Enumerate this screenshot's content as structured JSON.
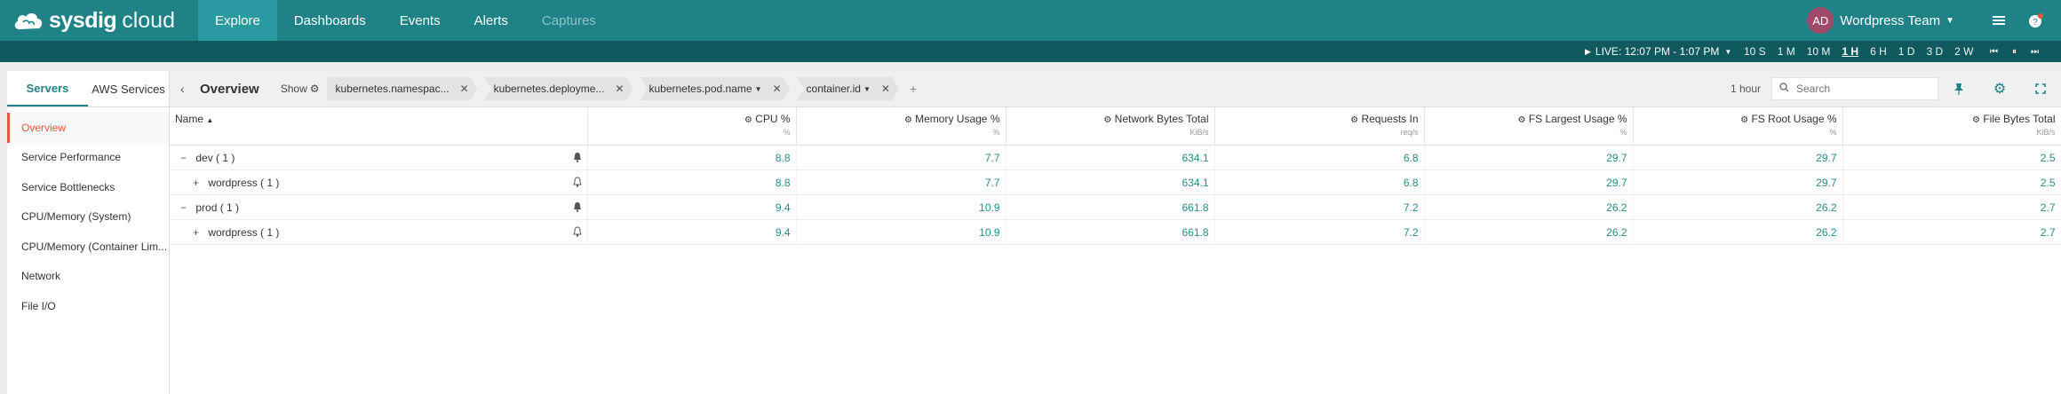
{
  "app": {
    "brand_bold": "sysdig",
    "brand_light": "cloud"
  },
  "nav": {
    "items": [
      {
        "label": "Explore"
      },
      {
        "label": "Dashboards"
      },
      {
        "label": "Events"
      },
      {
        "label": "Alerts"
      },
      {
        "label": "Captures"
      }
    ]
  },
  "user": {
    "initials": "AD",
    "team": "Wordpress Team"
  },
  "timebar": {
    "live": "LIVE: 12:07 PM - 1:07 PM",
    "ranges": [
      "10 S",
      "1 M",
      "10 M",
      "1 H",
      "6 H",
      "1 D",
      "3 D",
      "2 W"
    ],
    "active_range": "1 H"
  },
  "left": {
    "tabs": [
      {
        "label": "Servers"
      },
      {
        "label": "AWS Services"
      }
    ],
    "items": [
      {
        "label": "Overview"
      },
      {
        "label": "Service Performance"
      },
      {
        "label": "Service Bottlenecks"
      },
      {
        "label": "CPU/Memory (System)"
      },
      {
        "label": "CPU/Memory (Container Lim..."
      },
      {
        "label": "Network"
      },
      {
        "label": "File I/O"
      }
    ]
  },
  "toolbar": {
    "title": "Overview",
    "show_label": "Show",
    "breadcrumbs": [
      {
        "label": "kubernetes.namespac..."
      },
      {
        "label": "kubernetes.deployme..."
      },
      {
        "label": "kubernetes.pod.name"
      },
      {
        "label": "container.id"
      }
    ],
    "time": "1 hour",
    "search_placeholder": "Search"
  },
  "table": {
    "name_header": "Name",
    "columns": [
      {
        "label": "CPU %",
        "unit": "%"
      },
      {
        "label": "Memory Usage %",
        "unit": "%"
      },
      {
        "label": "Network Bytes Total",
        "unit": "KiB/s"
      },
      {
        "label": "Requests In",
        "unit": "req/s"
      },
      {
        "label": "FS Largest Usage %",
        "unit": "%"
      },
      {
        "label": "FS Root Usage %",
        "unit": "%"
      },
      {
        "label": "File Bytes Total",
        "unit": "KiB/s"
      }
    ],
    "rows": [
      {
        "name": "dev ( 1 )",
        "expander": "−",
        "values": [
          "8.8",
          "7.7",
          "634.1",
          "6.8",
          "29.7",
          "29.7",
          "2.5"
        ]
      },
      {
        "name": "wordpress ( 1 )",
        "expander": "+",
        "values": [
          "8.8",
          "7.7",
          "634.1",
          "6.8",
          "29.7",
          "29.7",
          "2.5"
        ]
      },
      {
        "name": "prod ( 1 )",
        "expander": "−",
        "values": [
          "9.4",
          "10.9",
          "661.8",
          "7.2",
          "26.2",
          "26.2",
          "2.7"
        ]
      },
      {
        "name": "wordpress ( 1 )",
        "expander": "+",
        "values": [
          "9.4",
          "10.9",
          "661.8",
          "7.2",
          "26.2",
          "26.2",
          "2.7"
        ]
      }
    ]
  }
}
